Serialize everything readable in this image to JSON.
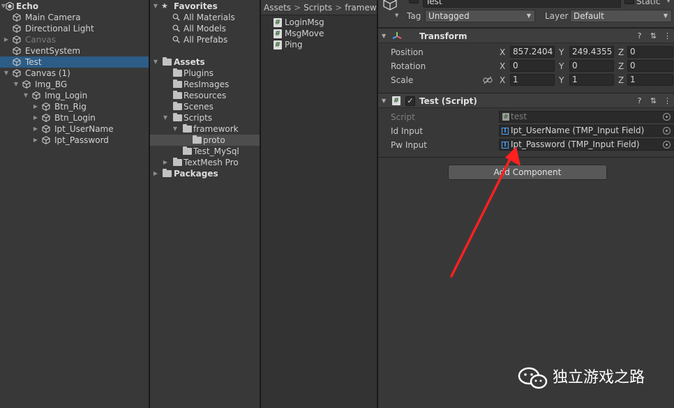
{
  "hierarchy": {
    "scene": "Echo",
    "items": [
      {
        "label": "Main Camera",
        "depth": 1
      },
      {
        "label": "Directional Light",
        "depth": 1
      },
      {
        "label": "Canvas",
        "depth": 1,
        "arrow": "▶",
        "dim": true
      },
      {
        "label": "EventSystem",
        "depth": 1
      },
      {
        "label": "Test",
        "depth": 1,
        "selected": true
      },
      {
        "label": "Canvas (1)",
        "depth": 1,
        "arrow": "▼"
      },
      {
        "label": "Img_BG",
        "depth": 2,
        "arrow": "▼"
      },
      {
        "label": "Img_Login",
        "depth": 3,
        "arrow": "▼"
      },
      {
        "label": "Btn_Rig",
        "depth": 4,
        "arrow": "▶"
      },
      {
        "label": "Btn_Login",
        "depth": 4,
        "arrow": "▶"
      },
      {
        "label": "Ipt_UserName",
        "depth": 4,
        "arrow": "▶"
      },
      {
        "label": "Ipt_Password",
        "depth": 4,
        "arrow": "▶"
      }
    ]
  },
  "project": {
    "favorites_label": "Favorites",
    "favorites": [
      "All Materials",
      "All Models",
      "All Prefabs"
    ],
    "assets_label": "Assets",
    "folders": [
      {
        "label": "Plugins",
        "depth": 2
      },
      {
        "label": "ResImages",
        "depth": 2
      },
      {
        "label": "Resources",
        "depth": 2
      },
      {
        "label": "Scenes",
        "depth": 2
      },
      {
        "label": "Scripts",
        "depth": 2,
        "arrow": "▼"
      },
      {
        "label": "framework",
        "depth": 3,
        "arrow": "▼"
      },
      {
        "label": "proto",
        "depth": 4,
        "selected": true
      },
      {
        "label": "Test_MySql",
        "depth": 3
      },
      {
        "label": "TextMesh Pro",
        "depth": 2,
        "arrow": "▶"
      }
    ],
    "packages_label": "Packages"
  },
  "assets_pane": {
    "breadcrumb": [
      "Assets",
      "Scripts",
      "framewo"
    ],
    "files": [
      "LoginMsg",
      "MsgMove",
      "Ping"
    ]
  },
  "inspector": {
    "object_name": "Test",
    "static_label": "Static",
    "tag_label": "Tag",
    "tag_value": "Untagged",
    "layer_label": "Layer",
    "layer_value": "Default",
    "transform": {
      "title": "Transform",
      "rows": [
        {
          "label": "Position",
          "x": "857.2404",
          "y": "249.4355",
          "z": "0"
        },
        {
          "label": "Rotation",
          "x": "0",
          "y": "0",
          "z": "0"
        },
        {
          "label": "Scale",
          "x": "1",
          "y": "1",
          "z": "1"
        }
      ],
      "axis": {
        "x": "X",
        "y": "Y",
        "z": "Z"
      }
    },
    "script_component": {
      "title": "Test (Script)",
      "fields": [
        {
          "label": "Script",
          "value": "test",
          "dim": true
        },
        {
          "label": "Id Input",
          "value": "Ipt_UserName (TMP_Input Field)"
        },
        {
          "label": "Pw Input",
          "value": "Ipt_Password (TMP_Input Field)"
        }
      ]
    },
    "add_component_label": "Add Component"
  },
  "watermark": {
    "text": "独立游戏之路"
  },
  "colors": {
    "selection": "#2c5d87",
    "arrow_annotation": "#ff2020"
  }
}
